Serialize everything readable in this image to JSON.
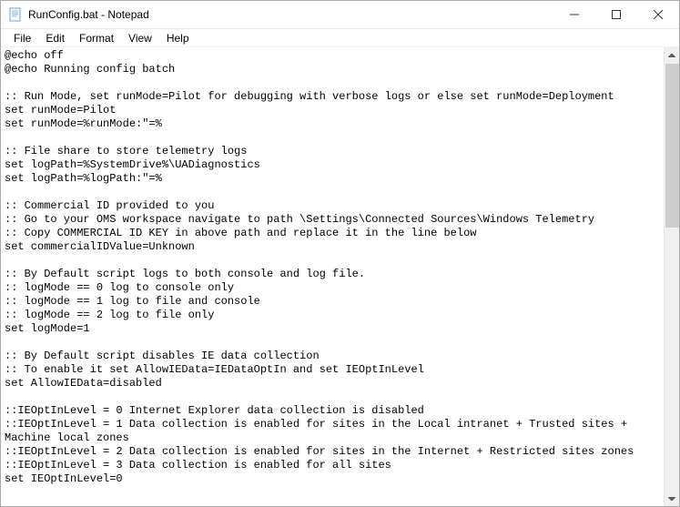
{
  "window": {
    "title": "RunConfig.bat - Notepad"
  },
  "menu": {
    "file": "File",
    "edit": "Edit",
    "format": "Format",
    "view": "View",
    "help": "Help"
  },
  "document": {
    "text": "@echo off\n@echo Running config batch\n\n:: Run Mode, set runMode=Pilot for debugging with verbose logs or else set runMode=Deployment\nset runMode=Pilot\nset runMode=%runMode:\"=%\n\n:: File share to store telemetry logs\nset logPath=%SystemDrive%\\UADiagnostics\nset logPath=%logPath:\"=%\n\n:: Commercial ID provided to you\n:: Go to your OMS workspace navigate to path \\Settings\\Connected Sources\\Windows Telemetry\n:: Copy COMMERCIAL ID KEY in above path and replace it in the line below\nset commercialIDValue=Unknown\n\n:: By Default script logs to both console and log file.\n:: logMode == 0 log to console only\n:: logMode == 1 log to file and console\n:: logMode == 2 log to file only\nset logMode=1\n\n:: By Default script disables IE data collection\n:: To enable it set AllowIEData=IEDataOptIn and set IEOptInLevel\nset AllowIEData=disabled\n\n::IEOptInLevel = 0 Internet Explorer data collection is disabled\n::IEOptInLevel = 1 Data collection is enabled for sites in the Local intranet + Trusted sites + Machine local zones\n::IEOptInLevel = 2 Data collection is enabled for sites in the Internet + Restricted sites zones\n::IEOptInLevel = 3 Data collection is enabled for all sites\nset IEOptInLevel=0\n"
  }
}
